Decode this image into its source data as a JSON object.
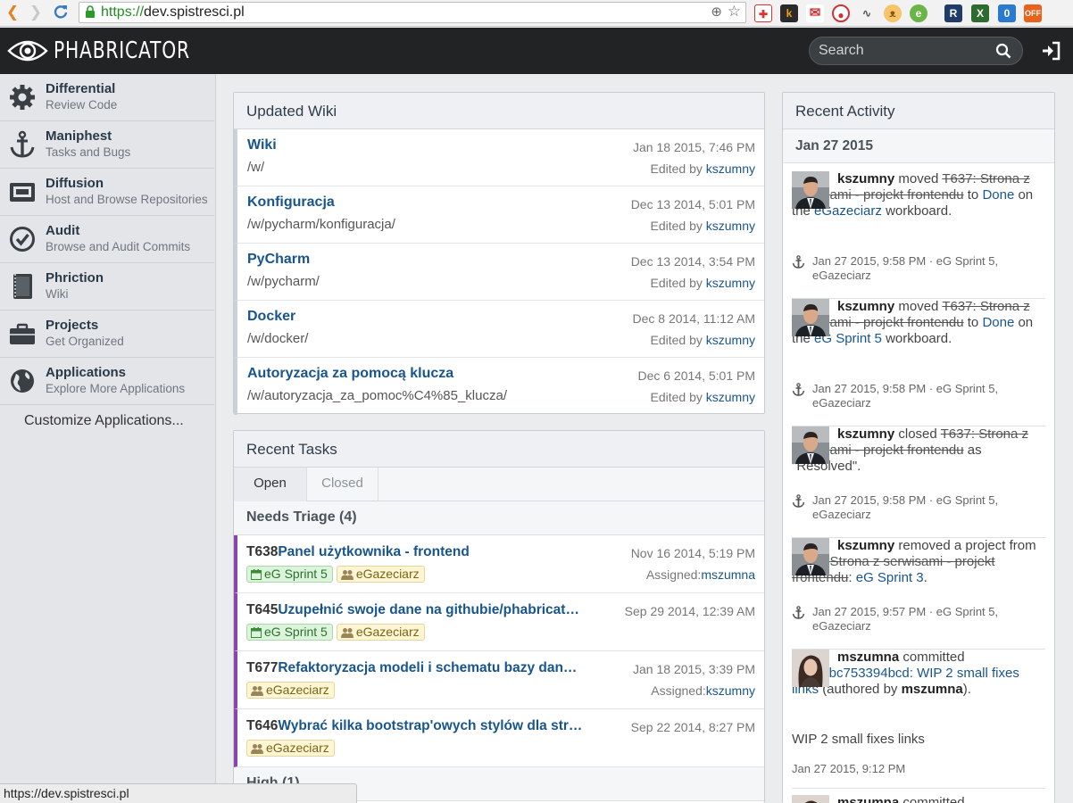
{
  "browser": {
    "url_scheme": "https://",
    "url_host": "dev.spistresci.pl",
    "extensions": [
      "first-aid-icon",
      "k-icon",
      "gmail-icon",
      "opera-icon",
      "pulse-icon",
      "cat-icon",
      "evernote-icon",
      "R",
      "X",
      "0",
      "OFF"
    ]
  },
  "header": {
    "app_name": "PHABRICATOR",
    "search_placeholder": "Search"
  },
  "sidebar": {
    "items": [
      {
        "title": "Differential",
        "subtitle": "Review Code",
        "icon": "gear-icon"
      },
      {
        "title": "Maniphest",
        "subtitle": "Tasks and Bugs",
        "icon": "anchor-icon"
      },
      {
        "title": "Diffusion",
        "subtitle": "Host and Browse Repositories",
        "icon": "repository-icon"
      },
      {
        "title": "Audit",
        "subtitle": "Browse and Audit Commits",
        "icon": "check-circle-icon"
      },
      {
        "title": "Phriction",
        "subtitle": "Wiki",
        "icon": "book-icon"
      },
      {
        "title": "Projects",
        "subtitle": "Get Organized",
        "icon": "briefcase-icon"
      },
      {
        "title": "Applications",
        "subtitle": "Explore More Applications",
        "icon": "globe-icon"
      }
    ],
    "customize": "Customize Applications..."
  },
  "wiki": {
    "title": "Updated Wiki",
    "edited_by_label": "Edited by",
    "rows": [
      {
        "title": "Wiki",
        "path": "/w/",
        "date": "Jan 18 2015, 7:46 PM",
        "user": "kszumny"
      },
      {
        "title": "Konfiguracja",
        "path": "/w/pycharm/konfiguracja/",
        "date": "Dec 13 2014, 5:01 PM",
        "user": "kszumny"
      },
      {
        "title": "PyCharm",
        "path": "/w/pycharm/",
        "date": "Dec 13 2014, 3:54 PM",
        "user": "kszumny"
      },
      {
        "title": "Docker",
        "path": "/w/docker/",
        "date": "Dec 8 2014, 11:12 AM",
        "user": "kszumny"
      },
      {
        "title": "Autoryzacja za pomocą klucza",
        "path": "/w/autoryzacja_za_pomoc%C4%85_klucza/",
        "date": "Dec 6 2014, 5:01 PM",
        "user": "kszumny"
      }
    ]
  },
  "tasks": {
    "title": "Recent Tasks",
    "tab_open": "Open",
    "tab_closed": "Closed",
    "group_title": "Needs Triage (4)",
    "next_group_title": "High (1)",
    "assigned_label": "Assigned:",
    "rows": [
      {
        "id": "T638",
        "title": "Panel użytkownika - frontend",
        "date": "Nov 16 2014, 5:19 PM",
        "assignee": "mszumna",
        "tags": [
          {
            "label": "eG Sprint 5",
            "kind": "sprint"
          },
          {
            "label": "eGazeciarz",
            "kind": "project"
          }
        ]
      },
      {
        "id": "T645",
        "title": "Uzupełnić swoje dane na githubie/phabricat…",
        "date": "Sep 29 2014, 12:39 AM",
        "assignee": "",
        "tags": [
          {
            "label": "eG Sprint 5",
            "kind": "sprint"
          },
          {
            "label": "eGazeciarz",
            "kind": "project"
          }
        ]
      },
      {
        "id": "T677",
        "title": "Refaktoryzacja modeli i schematu bazy dan…",
        "date": "Jan 18 2015, 3:39 PM",
        "assignee": "kszumny",
        "tags": [
          {
            "label": "eGazeciarz",
            "kind": "project"
          }
        ]
      },
      {
        "id": "T646",
        "title": "Wybrać kilka bootstrap'owych stylów dla str…",
        "date": "Sep 22 2014, 8:27 PM",
        "assignee": "",
        "tags": [
          {
            "label": "eGazeciarz",
            "kind": "project"
          }
        ]
      }
    ]
  },
  "activity": {
    "title": "Recent Activity",
    "date_header": "Jan 27 2015",
    "items": [
      {
        "user": "kszumny",
        "verb": "moved",
        "task": "T637: Strona z serwisami - projekt frontendu",
        "after_task": "to",
        "link1": "Done",
        "mid": "on the",
        "link2": "eGazeciarz",
        "tail": "workboard.",
        "meta1": "Jan 27 2015, 9:58 PM · eG Sprint 5,",
        "meta2": "eGazeciarz"
      },
      {
        "user": "kszumny",
        "verb": "moved",
        "task": "T637: Strona z serwisami - projekt frontendu",
        "after_task": "to",
        "link1": "Done",
        "mid": "on the",
        "link2": "eG Sprint 5",
        "tail": "workboard.",
        "meta1": "Jan 27 2015, 9:58 PM · eG Sprint 5,",
        "meta2": "eGazeciarz"
      },
      {
        "user": "kszumny",
        "verb": "closed",
        "task": "T637: Strona z serwisami - projekt frontendu",
        "after_task": "as \"Resolved\".",
        "meta1": "Jan 27 2015, 9:58 PM · eG Sprint 5,",
        "meta2": "eGazeciarz"
      },
      {
        "user": "kszumny",
        "verb": "removed a project from",
        "task": "T637: Strona z serwisami - projekt frontendu",
        "after_task": ":",
        "link1": "eG Sprint 3",
        "tail": ".",
        "meta1": "Jan 27 2015, 9:57 PM · eG Sprint 5,",
        "meta2": "eGazeciarz"
      },
      {
        "user": "mszumna",
        "verb": "committed",
        "commit": "rEGTcbc753394bcd: WIP 2 small fixes links",
        "authored_prefix": "(authored by",
        "author": "mszumna",
        "authored_suffix": ").",
        "message": "WIP 2 small fixes links",
        "meta1": "Jan 27 2015, 9:12 PM"
      },
      {
        "user": "mszumna",
        "verb": "committed"
      }
    ]
  },
  "status_bar": "https://dev.spistresci.pl",
  "colors": {
    "accent_link": "#19558d",
    "header_bg": "#212325",
    "task_border": "#8e44ad",
    "sprint_tag": "#dcf4dc",
    "project_tag": "#fdf5d4"
  }
}
